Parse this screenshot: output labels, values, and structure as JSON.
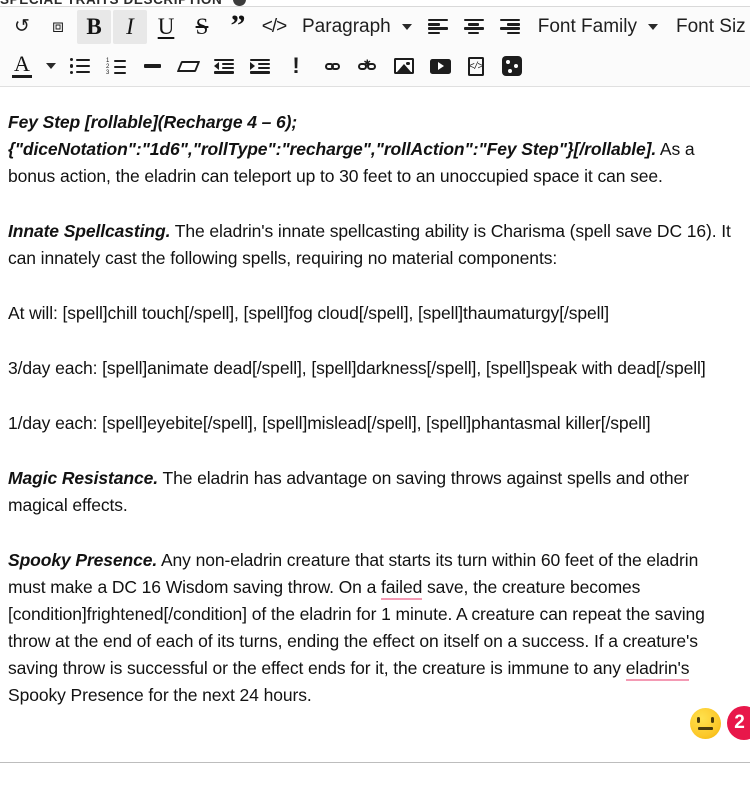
{
  "section": {
    "title": "SPECIAL TRAITS DESCRIPTION",
    "help_icon": "help-circle-icon"
  },
  "toolbar": {
    "row1": [
      {
        "name": "undo-button",
        "icon": "undo-icon",
        "glyph": "↺",
        "label": "Undo",
        "active": false
      },
      {
        "name": "paste-button",
        "icon": "paste-icon",
        "glyph": "⎘",
        "label": "Paste",
        "active": false
      },
      {
        "name": "bold-button",
        "icon": "bold-icon",
        "glyph": "B",
        "label": "Bold",
        "active": true
      },
      {
        "name": "italic-button",
        "icon": "italic-icon",
        "glyph": "I",
        "label": "Italic",
        "active": true
      },
      {
        "name": "underline-button",
        "icon": "underline-icon",
        "glyph": "U",
        "label": "Underline",
        "active": false
      },
      {
        "name": "strikethrough-button",
        "icon": "strikethrough-icon",
        "glyph": "S",
        "label": "Strikethrough",
        "active": false
      },
      {
        "name": "blockquote-button",
        "icon": "quote-icon",
        "glyph": "”",
        "label": "Blockquote",
        "active": false
      },
      {
        "name": "code-button",
        "icon": "code-icon",
        "glyph": "</>",
        "label": "Code",
        "active": false
      }
    ],
    "format_select": {
      "name": "paragraph-format-select",
      "value": "Paragraph",
      "caret": "chevron-down-icon"
    },
    "align": [
      {
        "name": "align-left-button",
        "icon": "align-left-icon",
        "label": "Align left"
      },
      {
        "name": "align-center-button",
        "icon": "align-center-icon",
        "label": "Align center"
      },
      {
        "name": "align-right-button",
        "icon": "align-right-icon",
        "label": "Align right"
      }
    ],
    "font_family_select": {
      "name": "font-family-select",
      "value": "Font Family",
      "caret": "chevron-down-icon"
    },
    "font_sizes_select": {
      "name": "font-sizes-select",
      "value": "Font Sizes",
      "caret": "chevron-down-icon"
    },
    "row2": [
      {
        "name": "text-color-button",
        "icon": "text-color-icon",
        "label": "Text color"
      },
      {
        "name": "text-color-dropdown",
        "icon": "chevron-down-icon",
        "label": "Text color options"
      },
      {
        "name": "bullet-list-button",
        "icon": "bullet-list-icon",
        "label": "Bulleted list"
      },
      {
        "name": "numbered-list-button",
        "icon": "numbered-list-icon",
        "label": "Numbered list"
      },
      {
        "name": "horizontal-rule-button",
        "icon": "horizontal-rule-icon",
        "label": "Horizontal rule"
      },
      {
        "name": "clear-format-button",
        "icon": "eraser-icon",
        "label": "Clear formatting"
      },
      {
        "name": "outdent-button",
        "icon": "outdent-icon",
        "label": "Decrease indent"
      },
      {
        "name": "indent-button",
        "icon": "indent-icon",
        "label": "Increase indent"
      },
      {
        "name": "special-character-button",
        "icon": "exclamation-icon",
        "label": "Special character"
      },
      {
        "name": "insert-link-button",
        "icon": "link-icon",
        "label": "Insert link"
      },
      {
        "name": "remove-link-button",
        "icon": "unlink-icon",
        "label": "Remove link"
      },
      {
        "name": "insert-image-button",
        "icon": "image-icon",
        "label": "Insert image"
      },
      {
        "name": "insert-video-button",
        "icon": "video-icon",
        "label": "Insert video"
      },
      {
        "name": "insert-embed-button",
        "icon": "embed-file-icon",
        "label": "Insert embed"
      },
      {
        "name": "insert-dice-roll-button",
        "icon": "dice-icon",
        "label": "Insert dice roll"
      }
    ]
  },
  "content": {
    "paragraphs": [
      {
        "bold_italic": "Fey Step [rollable](Recharge 4 – 6); {\"diceNotation\":\"1d6\",\"rollType\":\"recharge\",\"rollAction\":\"Fey Step\"}[/rollable].",
        "rest": " As a bonus action, the eladrin can teleport up to 30 feet to an unoccupied space it can see."
      },
      {
        "bold_italic": "Innate Spellcasting.",
        "rest": " The eladrin's innate spellcasting ability is Charisma (spell save DC 16). It can innately cast the following spells, requiring no material components:"
      },
      {
        "bold_italic": "",
        "rest": "At will: [spell]chill touch[/spell], [spell]fog cloud[/spell], [spell]thaumaturgy[/spell]"
      },
      {
        "bold_italic": "",
        "rest": "3/day each: [spell]animate dead[/spell], [spell]darkness[/spell], [spell]speak with dead[/spell]"
      },
      {
        "bold_italic": "",
        "rest": "1/day each: [spell]eyebite[/spell], [spell]mislead[/spell], [spell]phantasmal killer[/spell]"
      },
      {
        "bold_italic": "Magic Resistance.",
        "rest": " The eladrin has advantage on saving throws against spells and other magical effects."
      }
    ],
    "spooky": {
      "bold_italic": "Spooky Presence.",
      "seg1": " Any non-eladrin creature that starts its turn within 60 feet of the eladrin must make a DC 16 Wisdom saving throw. On a ",
      "misspelled1": "failed",
      "seg2": " save, the creature becomes [condition]frightened[/condition] of the eladrin for 1 minute. A creature can repeat the saving throw at the end of each of its turns, ending the effect on itself on a success. If a creature's saving throw is successful or the effect ends for it, the creature is immune to any ",
      "misspelled2": "eladrin's",
      "seg3": " Spooky Presence for the next 24 hours."
    }
  },
  "widgets": {
    "emoji_button": {
      "name": "feedback-emoji-button",
      "icon": "neutral-face-emoji",
      "color": "#fcc82a"
    },
    "notification_badge": {
      "name": "notification-badge-button",
      "count": "2",
      "color": "#e8174a"
    }
  }
}
